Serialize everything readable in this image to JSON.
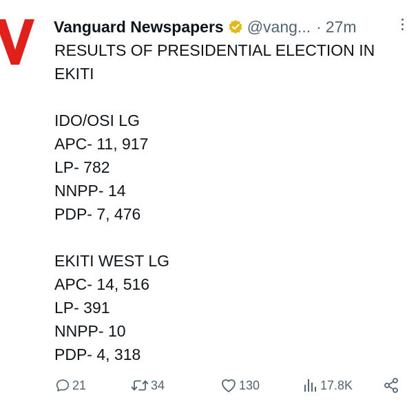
{
  "tweet": {
    "author_name": "Vanguard Newspapers",
    "handle": "@vang...",
    "separator": "·",
    "time": "27m",
    "body": {
      "title_line1": "RESULTS OF PRESIDENTIAL ELECTION IN",
      "title_line2": "EKITI",
      "section1": {
        "lg": "IDO/OSI LG",
        "apc": "APC- 11, 917",
        "lp": "LP- 782",
        "nnpp": "NNPP- 14",
        "pdp": "PDP- 7, 476"
      },
      "section2": {
        "lg": "EKITI WEST LG",
        "apc": "APC- 14, 516",
        "lp": "LP- 391",
        "nnpp": "NNPP- 10",
        "pdp": "PDP- 4, 318"
      }
    },
    "actions": {
      "replies": "21",
      "retweets": "34",
      "likes": "130",
      "views": "17.8K"
    }
  },
  "icons": {
    "avatar": "vanguard-logo-v",
    "verified": "verified-badge-icon",
    "more": "more-options-icon",
    "reply": "reply-icon",
    "retweet": "retweet-icon",
    "like": "heart-icon",
    "views": "analytics-icon",
    "share": "share-icon"
  },
  "colors": {
    "brand_red": "#e0201b",
    "verified_gold": "#e2b719",
    "text": "#0f1419",
    "muted": "#536471"
  }
}
